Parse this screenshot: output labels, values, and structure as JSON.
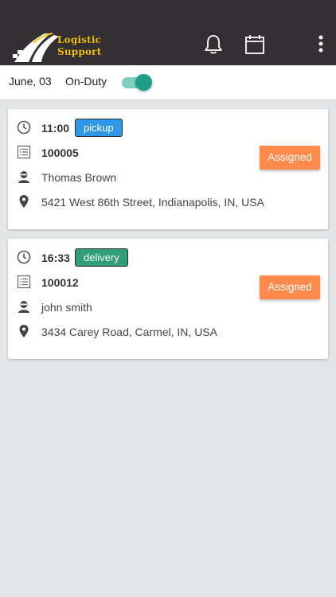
{
  "app": {
    "logo_line1": "Logistic",
    "logo_line2": "Support",
    "logo_text_color": "#f4c20d",
    "appbar_color": "#332f33",
    "icons": [
      "bell-icon",
      "calendar-icon",
      "more-vert-icon"
    ]
  },
  "status": {
    "date": "June, 03",
    "duty_label": "On-Duty",
    "on_duty": true,
    "toggle_color": "#1f9e87"
  },
  "jobs": [
    {
      "time": "11:00",
      "type": "pickup",
      "type_color": "#2f97e8",
      "order_id": "100005",
      "customer": "Thomas Brown",
      "address": "5421 West 86th Street, Indianapolis, IN, USA",
      "status": "Assigned",
      "status_color": "#ff8a4c"
    },
    {
      "time": "16:33",
      "type": "delivery",
      "type_color": "#2f9e78",
      "order_id": "100012",
      "customer": "john smith",
      "address": "3434 Carey Road, Carmel, IN, USA",
      "status": "Assigned",
      "status_color": "#ff8a4c"
    }
  ]
}
